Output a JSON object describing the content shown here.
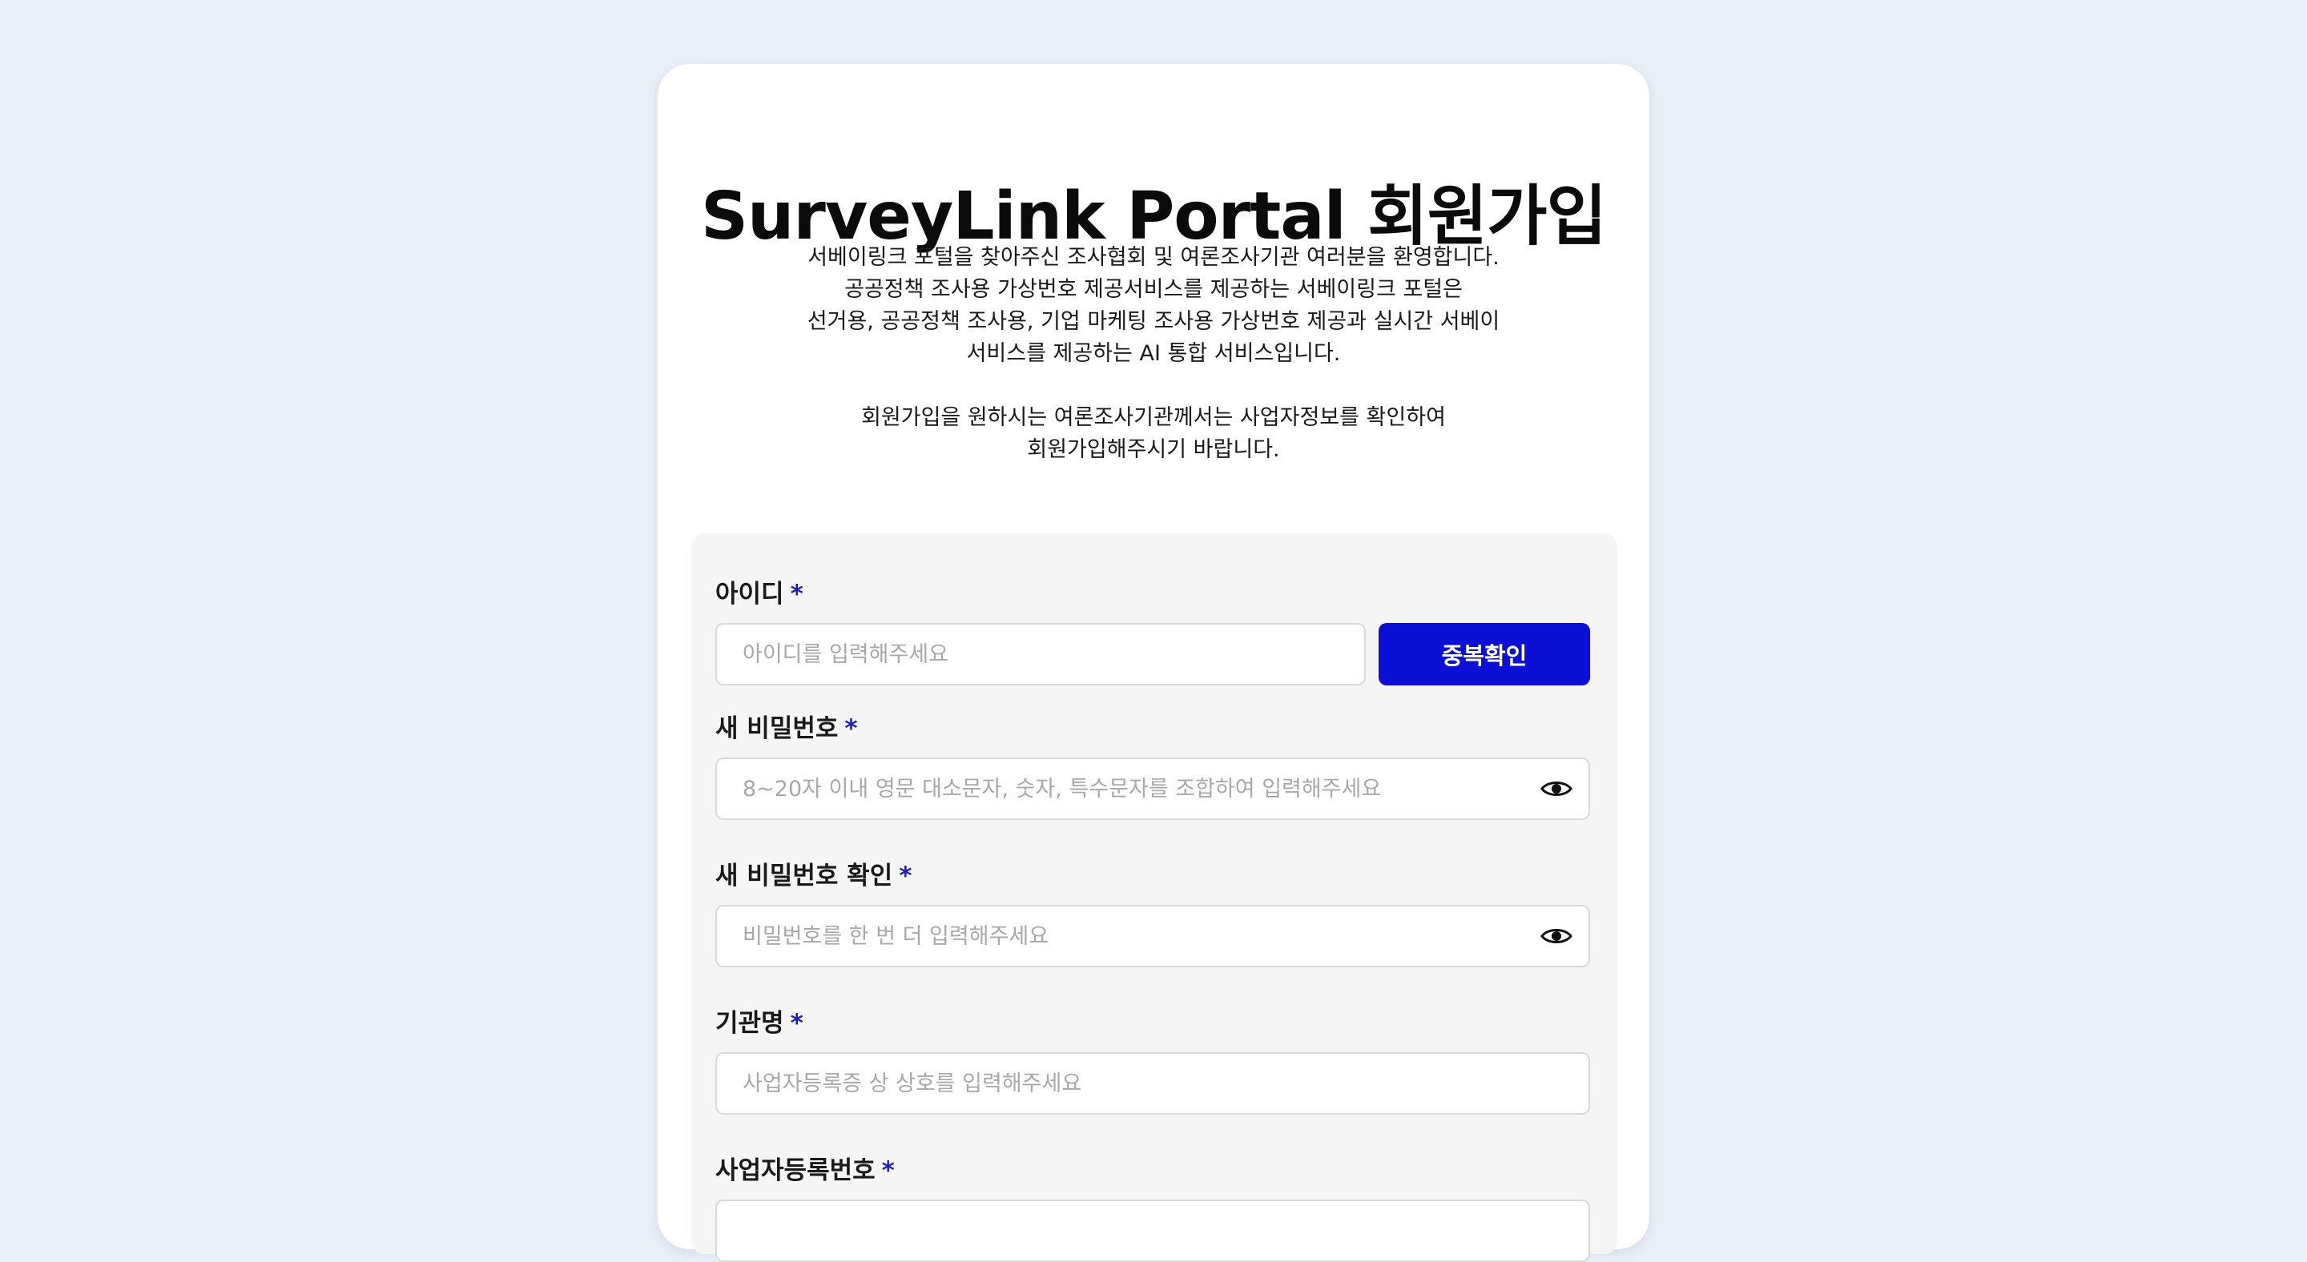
{
  "header": {
    "title": "SurveyLink Portal 회원가입",
    "intro_lines": [
      "서베이링크 포털을 찾아주신 조사협회 및 여론조사기관 여러분을 환영합니다.",
      "공공정책 조사용 가상번호 제공서비스를 제공하는 서베이링크 포털은",
      "선거용, 공공정책 조사용, 기업 마케팅 조사용 가상번호 제공과 실시간 서베이",
      "서비스를 제공하는 AI 통합 서비스입니다."
    ],
    "notice_lines": [
      "회원가입을 원하시는 여론조사기관께서는 사업자정보를 확인하여",
      "회원가입해주시기 바랍니다."
    ]
  },
  "form": {
    "required_mark": "*",
    "user_id": {
      "label": "아이디",
      "placeholder": "아이디를 입력해주세요",
      "check_button": "중복확인"
    },
    "new_password": {
      "label": "새 비밀번호",
      "placeholder": "8~20자 이내 영문 대소문자, 숫자, 특수문자를 조합하여 입력해주세요",
      "icon": "eye-icon"
    },
    "confirm_password": {
      "label": "새 비밀번호 확인",
      "placeholder": "비밀번호를 한 번 더 입력해주세요",
      "icon": "eye-icon"
    },
    "org_name": {
      "label": "기관명",
      "placeholder": "사업자등록증 상 상호를 입력해주세요"
    },
    "business_number": {
      "label": "사업자등록번호"
    }
  },
  "colors": {
    "background": "#e9eff7",
    "accent": "#0c0fd6",
    "required": "#1f1fbf"
  }
}
